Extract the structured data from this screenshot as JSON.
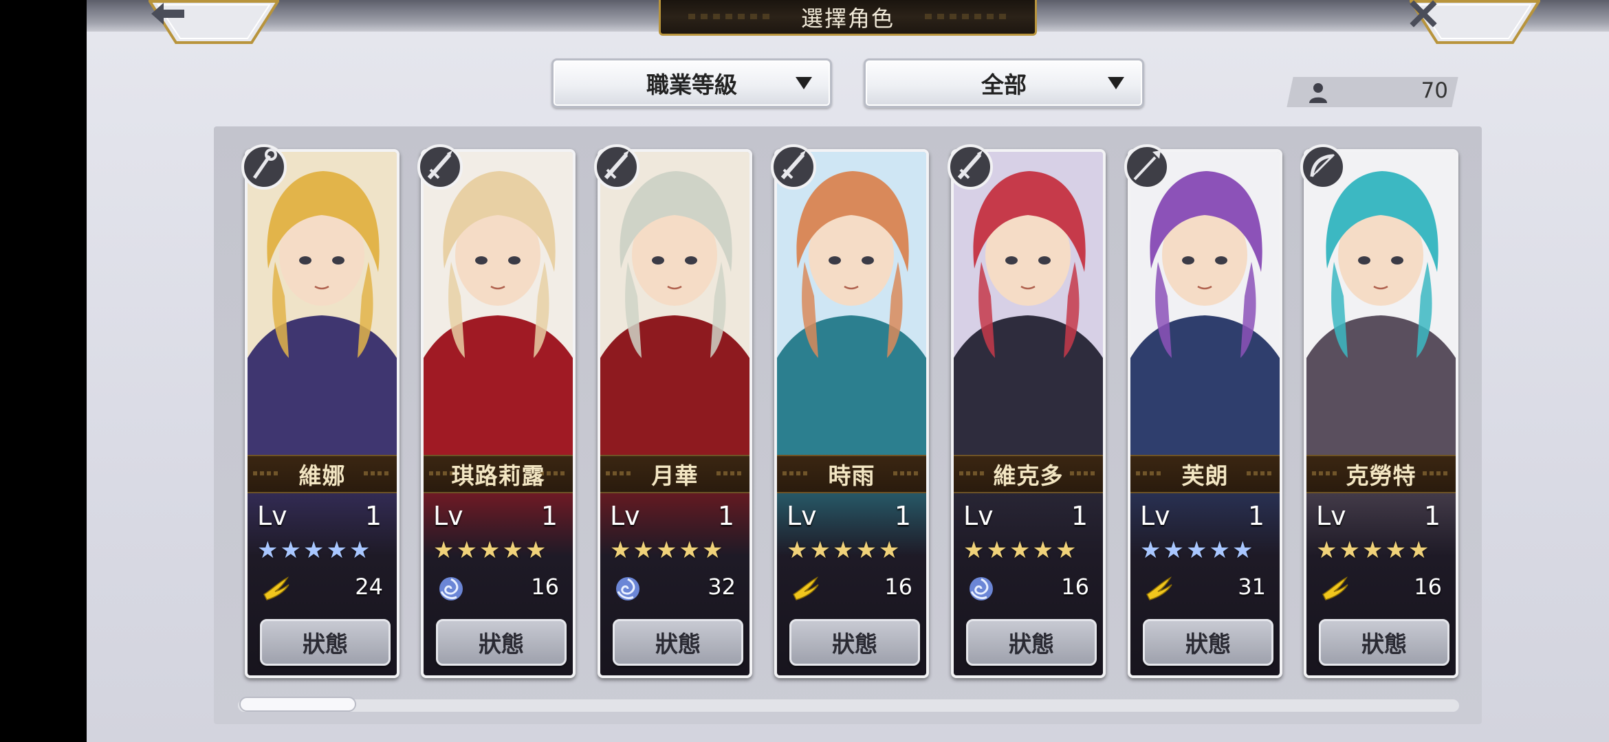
{
  "header": {
    "title": "選擇角色",
    "back_icon": "left-arrow-icon",
    "close_icon": "close-x-icon"
  },
  "filters": {
    "job_level": "職業等級",
    "scope": "全部"
  },
  "character_count": "70",
  "characters": [
    {
      "name": "維娜",
      "lv_label": "Lv",
      "level": "1",
      "stars": 5,
      "star_color": "#a9c7ff",
      "element": "wind",
      "count": "24",
      "status": "狀態",
      "class_icon": "staff-icon",
      "palette": [
        "#efe3c8",
        "#e2b44a",
        "#3f3670"
      ]
    },
    {
      "name": "琪路莉露",
      "lv_label": "Lv",
      "level": "1",
      "stars": 5,
      "star_color": "#f0d27a",
      "element": "water",
      "count": "16",
      "status": "狀態",
      "class_icon": "sword-icon",
      "palette": [
        "#f2ede6",
        "#e8d0a4",
        "#a01a24"
      ]
    },
    {
      "name": "月華",
      "lv_label": "Lv",
      "level": "1",
      "stars": 5,
      "star_color": "#f0d27a",
      "element": "water",
      "count": "32",
      "status": "狀態",
      "class_icon": "sword-icon",
      "palette": [
        "#efe8dc",
        "#cfd3c7",
        "#8e1a1f"
      ]
    },
    {
      "name": "時雨",
      "lv_label": "Lv",
      "level": "1",
      "stars": 5,
      "star_color": "#f0d27a",
      "element": "wind",
      "count": "16",
      "status": "狀態",
      "class_icon": "sword-icon",
      "palette": [
        "#cfe6f4",
        "#d9895a",
        "#2c7f8f"
      ]
    },
    {
      "name": "維克多",
      "lv_label": "Lv",
      "level": "1",
      "stars": 5,
      "star_color": "#f0d27a",
      "element": "water",
      "count": "16",
      "status": "狀態",
      "class_icon": "sword-icon",
      "palette": [
        "#d7d0e6",
        "#c63a4a",
        "#2e2c3d"
      ]
    },
    {
      "name": "芙朗",
      "lv_label": "Lv",
      "level": "1",
      "stars": 5,
      "star_color": "#a9c7ff",
      "element": "wind",
      "count": "31",
      "status": "狀態",
      "class_icon": "spear-icon",
      "palette": [
        "#f1f1f4",
        "#8c52b8",
        "#2f3e6d"
      ]
    },
    {
      "name": "克勞特",
      "lv_label": "Lv",
      "level": "1",
      "stars": 5,
      "star_color": "#f0d27a",
      "element": "wind",
      "count": "16",
      "status": "狀態",
      "class_icon": "bow-icon",
      "palette": [
        "#f2f2f4",
        "#3cb8c2",
        "#5a4f5e"
      ]
    }
  ]
}
